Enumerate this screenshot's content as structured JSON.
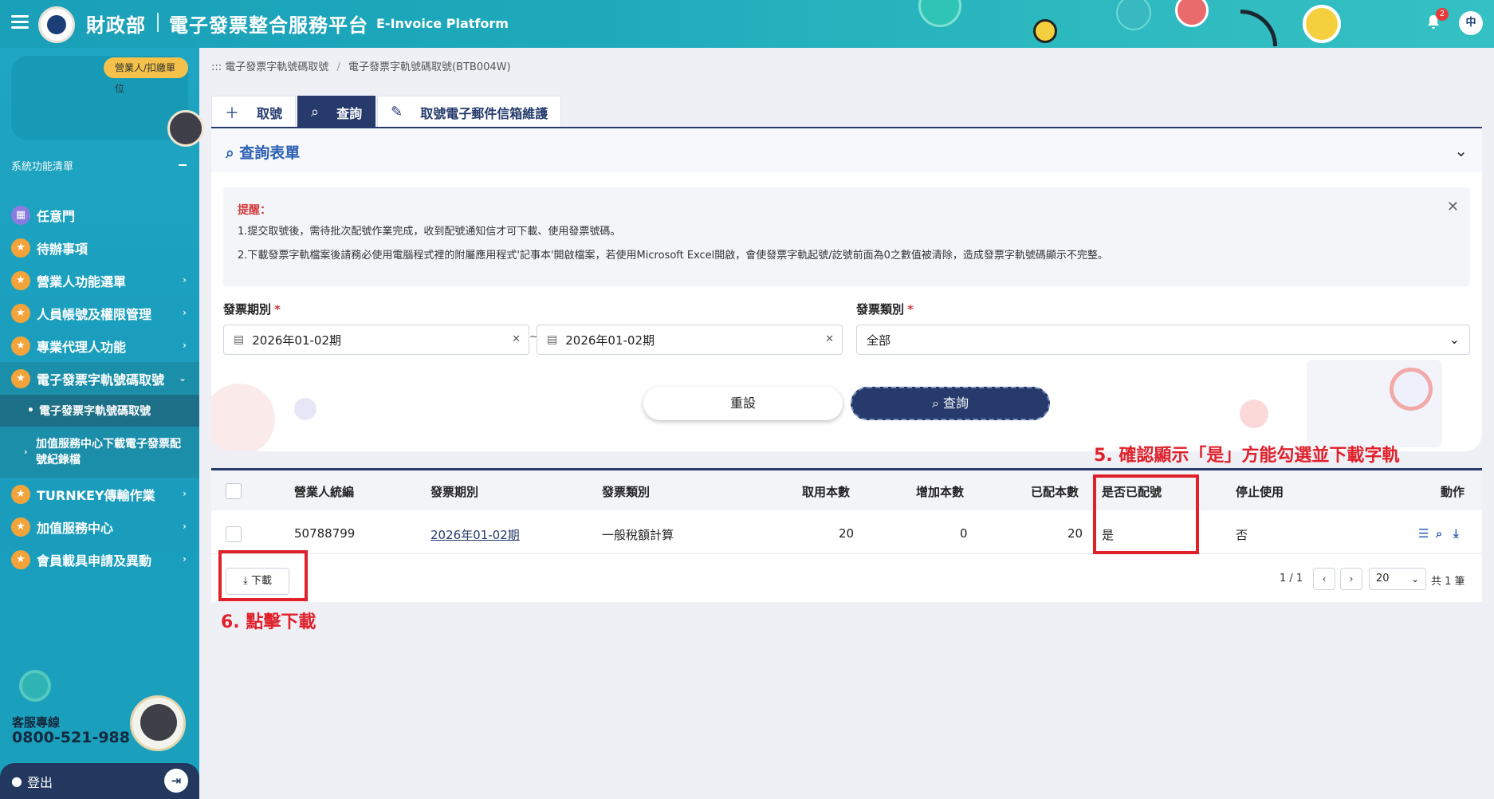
{
  "header": {
    "ministry": "財政部",
    "platform": "電子發票整合服務平台",
    "platform_en": "E-Invoice Platform",
    "notification_count": "2",
    "lang": "中"
  },
  "sidebar": {
    "role_tag": "營業人/扣繳單位",
    "menu_title": "系統功能清單",
    "items": [
      {
        "label": "任意門",
        "icon": "map-icon"
      },
      {
        "label": "待辦事項",
        "icon": "star-icon"
      },
      {
        "label": "營業人功能選單",
        "icon": "star-icon"
      },
      {
        "label": "人員帳號及權限管理",
        "icon": "star-icon"
      },
      {
        "label": "專業代理人功能",
        "icon": "star-icon"
      },
      {
        "label": "電子發票字軌號碼取號",
        "icon": "star-icon"
      },
      {
        "label": "TURNKEY傳輸作業",
        "icon": "star-icon"
      },
      {
        "label": "加值服務中心",
        "icon": "star-icon"
      },
      {
        "label": "會員載具申請及異動",
        "icon": "star-icon"
      }
    ],
    "sub_items": [
      {
        "label": "電子發票字軌號碼取號"
      },
      {
        "label_line1": "加值服務中心下載電子發票配",
        "label_line2": "號紀錄檔"
      }
    ],
    "hotline_label": "客服專線",
    "hotline_number": "0800-521-988",
    "logout": "登出"
  },
  "breadcrumb": {
    "prefix": ":::",
    "parent": "電子發票字軌號碼取號",
    "current": "電子發票字軌號碼取號(BTB004W)"
  },
  "tabs": [
    {
      "label": "取號",
      "icon": "plus-icon"
    },
    {
      "label": "查詢",
      "icon": "search-icon"
    },
    {
      "label": "取號電子郵件信箱維護",
      "icon": "edit-icon"
    }
  ],
  "query": {
    "title": "查詢表單",
    "notice_title": "提醒：",
    "notice_line1": "1.提交取號後，需待批次配號作業完成，收到配號通知信才可下載、使用發票號碼。",
    "notice_line2": "2.下載發票字軌檔案後請務必使用電腦程式裡的附屬應用程式'記事本'開啟檔案，若使用Microsoft Excel開啟，會使發票字軌起號/訖號前面為0之數值被清除，造成發票字軌號碼顯示不完整。",
    "period_label": "發票期別",
    "period_from": "2026年01-02期",
    "period_to": "2026年01-02期",
    "tilde": "~",
    "type_label": "發票類別",
    "type_value": "全部",
    "reset_label": "重設",
    "query_label": "查詢",
    "required_mark": "*"
  },
  "table": {
    "headers": [
      "營業人統編",
      "發票期別",
      "發票類別",
      "取用本數",
      "增加本數",
      "已配本數",
      "是否已配號",
      "停止使用",
      "動作"
    ],
    "rows": [
      {
        "ban": "50788799",
        "period": "2026年01-02期",
        "type": "一般稅額計算",
        "used": "20",
        "added": "0",
        "assigned": "20",
        "is_assigned": "是",
        "stopped": "否"
      }
    ],
    "download_label": "下載",
    "page_info": "1 / 1",
    "page_size": "20",
    "total": "共 1 筆"
  },
  "annotations": {
    "step5": "5. 確認顯示「是」方能勾選並下載字軌",
    "step6": "6. 點擊下載"
  },
  "colors": {
    "header_bg": "#1fa6c2",
    "primary": "#263a6b",
    "annotation": "#e0202a",
    "accent_orange": "#f2a43a"
  }
}
